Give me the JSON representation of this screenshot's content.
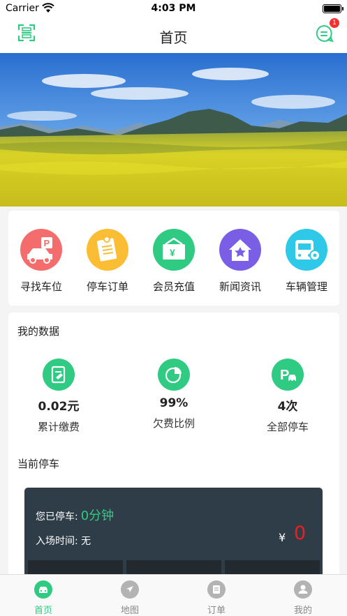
{
  "status_bar": {
    "carrier": "Carrier",
    "time": "4:03 PM"
  },
  "header": {
    "title": "首页",
    "badge": "1",
    "icons": {
      "left": "scan-icon",
      "right": "message-icon"
    }
  },
  "menu": [
    {
      "label": "寻找车位",
      "icon": "parking-car-icon",
      "color": "#f46c6c"
    },
    {
      "label": "停车订单",
      "icon": "order-note-icon",
      "color": "#fbbd33"
    },
    {
      "label": "会员充值",
      "icon": "wallet-yen-icon",
      "color": "#2fcb82"
    },
    {
      "label": "新闻资讯",
      "icon": "news-home-icon",
      "color": "#7a5fe6"
    },
    {
      "label": "车辆管理",
      "icon": "bus-gear-icon",
      "color": "#2ec8e8"
    }
  ],
  "my_data": {
    "title": "我的数据",
    "stats": [
      {
        "value": "0.02元",
        "label": "累计缴费",
        "icon": "payment-doc-icon"
      },
      {
        "value": "99%",
        "label": "欠费比例",
        "icon": "pie-chart-icon"
      },
      {
        "value": "4次",
        "label": "全部停车",
        "icon": "parking-p-icon"
      }
    ]
  },
  "current_parking": {
    "title": "当前停车",
    "duration_label": "您已停车:",
    "duration_value": "0分钟",
    "entry_label": "入场时间:",
    "entry_value": "无",
    "currency": "¥",
    "amount": "0"
  },
  "tabs": [
    {
      "label": "首页",
      "icon": "car-home-icon",
      "active": true
    },
    {
      "label": "地图",
      "icon": "navigation-icon",
      "active": false
    },
    {
      "label": "订单",
      "icon": "order-list-icon",
      "active": false
    },
    {
      "label": "我的",
      "icon": "user-icon",
      "active": false
    }
  ],
  "colors": {
    "accent": "#2fcb82",
    "price": "#f01d1d",
    "card_dark": "#2f3d48"
  }
}
